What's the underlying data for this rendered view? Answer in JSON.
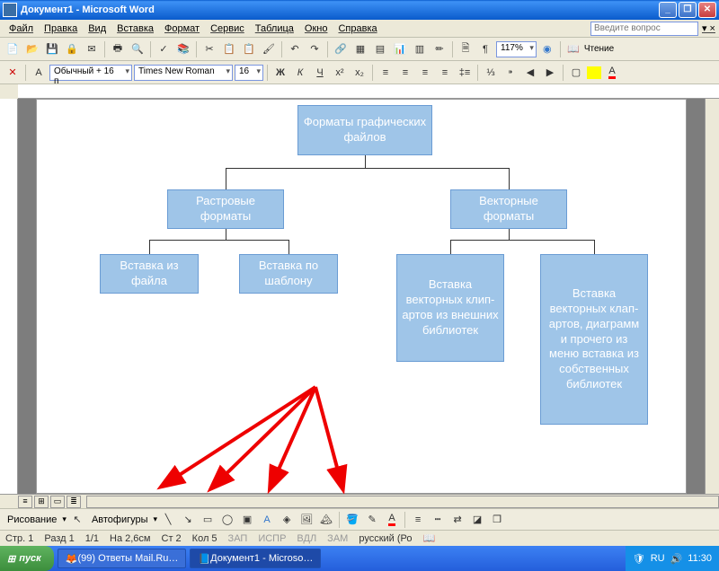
{
  "title": "Документ1 - Microsoft Word",
  "menu": [
    "Файл",
    "Правка",
    "Вид",
    "Вставка",
    "Формат",
    "Сервис",
    "Таблица",
    "Окно",
    "Справка"
  ],
  "ask_placeholder": "Введите вопрос",
  "zoom": "117%",
  "read": "Чтение",
  "style": "Обычный + 16 п",
  "font": "Times New Roman",
  "size": "16",
  "draw_label": "Рисование",
  "autoshapes": "Автофигуры",
  "status": {
    "page": "Стр. 1",
    "sect": "Разд 1",
    "pgs": "1/1",
    "at": "На 2,6см",
    "ln": "Ст 2",
    "col": "Кол 5",
    "rec": "ЗАП",
    "trk": "ИСПР",
    "ext": "ВДЛ",
    "ovr": "ЗАМ",
    "lang": "русский (Ро"
  },
  "tasks": [
    "(99) Ответы Mail.Ru…",
    "Документ1 - Microso…"
  ],
  "start": "пуск",
  "clock": "11:30",
  "lang_ind": "RU",
  "diagram": {
    "root": "Форматы графических файлов",
    "l2a": "Растровые форматы",
    "l2b": "Векторные форматы",
    "l3a": "Вставка из файла",
    "l3b": "Вставка по шаблону",
    "l3c": "Вставка векторных клип-артов из внешних библиотек",
    "l3d": "Вставка векторных клап-артов, диаграмм и прочего из меню вставка из собственных библиотек"
  }
}
